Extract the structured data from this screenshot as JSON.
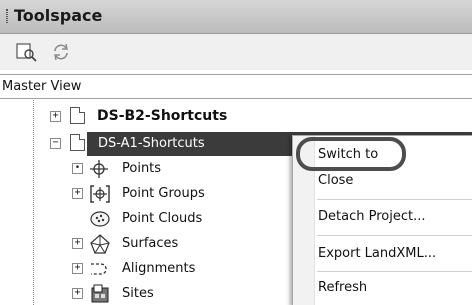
{
  "panel": {
    "title": "Toolspace"
  },
  "toolbar": {
    "icons": [
      "search-drawing-icon",
      "refresh-icon"
    ]
  },
  "view": {
    "label": "Master View"
  },
  "tree": {
    "b2": {
      "label": "DS-B2-Shortcuts",
      "expander": "+"
    },
    "a1": {
      "label": "DS-A1-Shortcuts",
      "expander": "−"
    },
    "children": [
      {
        "label": "Points",
        "expander": "•"
      },
      {
        "label": "Point Groups",
        "expander": "+"
      },
      {
        "label": "Point Clouds",
        "expander": ""
      },
      {
        "label": "Surfaces",
        "expander": "+"
      },
      {
        "label": "Alignments",
        "expander": "+"
      },
      {
        "label": "Sites",
        "expander": "+"
      }
    ]
  },
  "context_menu": {
    "items": [
      "Switch to",
      "Close",
      "Detach Project...",
      "Export LandXML...",
      "Refresh"
    ]
  },
  "colors": {
    "selection": "#3b3b3b",
    "titlebar": "#c8c8c8",
    "oval": "#4d4d4d"
  }
}
